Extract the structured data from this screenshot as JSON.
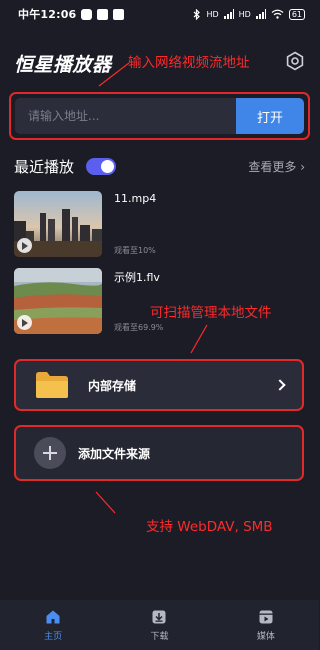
{
  "status_bar": {
    "time": "中午12:06",
    "signal_left": "HD",
    "signal_right": "HD",
    "battery": "61"
  },
  "header": {
    "title": "恒星播放器"
  },
  "annotations": {
    "url": "输入网络视频流地址",
    "local": "可扫描管理本地文件",
    "remote": "支持 WebDAV, SMB"
  },
  "url_box": {
    "placeholder": "请输入地址...",
    "open_label": "打开"
  },
  "recent": {
    "title": "最近播放",
    "see_more": "查看更多 ›",
    "items": [
      {
        "name": "11.mp4",
        "progress": "观看至10%"
      },
      {
        "name": "示例1.flv",
        "progress": "观看至69.9%"
      }
    ]
  },
  "storage": {
    "internal_label": "内部存储",
    "add_source_label": "添加文件来源"
  },
  "nav": {
    "items": [
      {
        "label": "主页"
      },
      {
        "label": "下载"
      },
      {
        "label": "媒体"
      }
    ]
  },
  "colors": {
    "background": "#1b1c26",
    "accent_blue": "#3f86e8",
    "toggle": "#5b5ff0",
    "annotation_red": "#ff2a2a",
    "folder_yellow": "#f4c04e"
  }
}
